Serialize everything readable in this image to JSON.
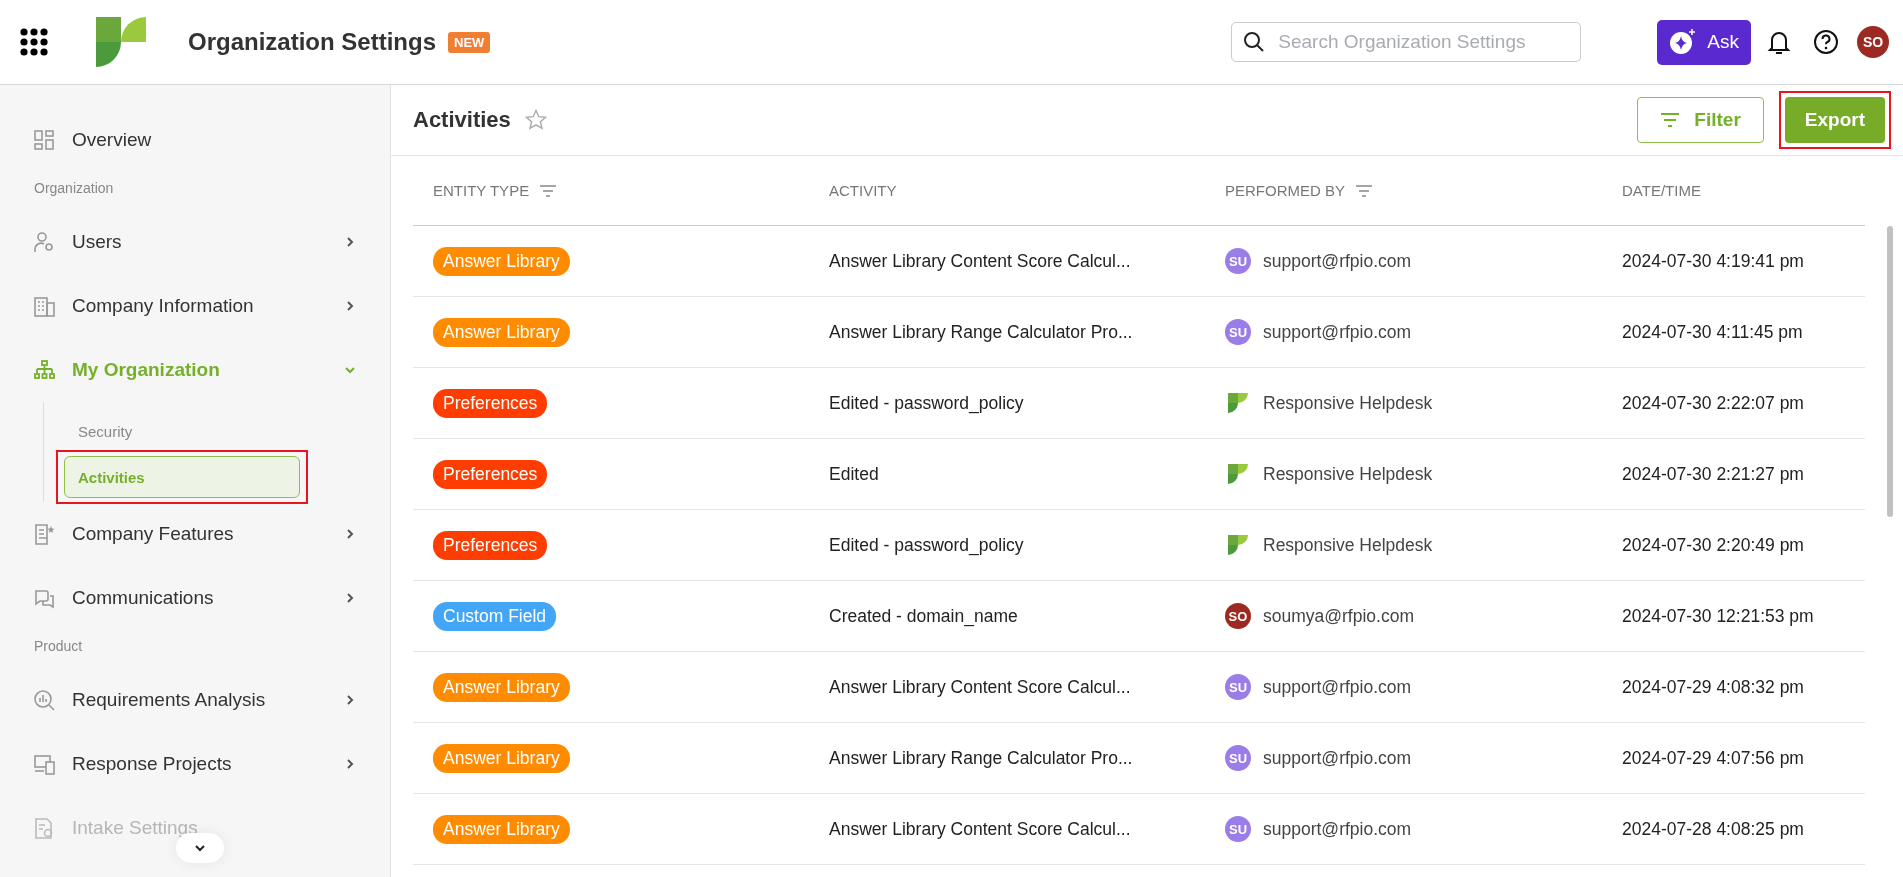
{
  "header": {
    "title": "Organization Settings",
    "badge": "NEW",
    "search": {
      "placeholder": "Search Organization Settings"
    },
    "ask_button": "Ask",
    "user_avatar": "SO"
  },
  "sidebar": {
    "items": [
      {
        "kind": "link",
        "label": "Overview",
        "selected": false,
        "disabled": false
      },
      {
        "kind": "heading",
        "label": "Organization"
      },
      {
        "kind": "group",
        "label": "Users",
        "selected": false,
        "expanded": false,
        "disabled": false
      },
      {
        "kind": "group",
        "label": "Company Information",
        "selected": false,
        "expanded": false,
        "disabled": false
      },
      {
        "kind": "group",
        "label": "My Organization",
        "selected": true,
        "expanded": true,
        "disabled": false,
        "children": [
          {
            "label": "Security",
            "selected": false,
            "highlighted": false
          },
          {
            "label": "Activities",
            "selected": true,
            "highlighted": true
          }
        ]
      },
      {
        "kind": "group",
        "label": "Company Features",
        "selected": false,
        "expanded": false,
        "disabled": false
      },
      {
        "kind": "group",
        "label": "Communications",
        "selected": false,
        "expanded": false,
        "disabled": false
      },
      {
        "kind": "heading",
        "label": "Product"
      },
      {
        "kind": "group",
        "label": "Requirements Analysis",
        "selected": false,
        "expanded": false,
        "disabled": false
      },
      {
        "kind": "group",
        "label": "Response Projects",
        "selected": false,
        "expanded": false,
        "disabled": false
      },
      {
        "kind": "link",
        "label": "Intake Settings",
        "selected": false,
        "disabled": true
      }
    ]
  },
  "main": {
    "title": "Activities",
    "favorite": false,
    "filter_button": "Filter",
    "export_button": {
      "label": "Export",
      "highlighted": true
    },
    "table": {
      "columns": [
        {
          "label": "ENTITY TYPE",
          "filterable": true
        },
        {
          "label": "ACTIVITY",
          "filterable": false
        },
        {
          "label": "PERFORMED BY",
          "filterable": true
        },
        {
          "label": "DATE/TIME",
          "filterable": false
        }
      ],
      "rows": [
        {
          "entity": {
            "label": "Answer Library",
            "color": "#ff8c00"
          },
          "activity": "Answer Library Content Score Calcul...",
          "performer": {
            "kind": "user",
            "initials": "SU",
            "color": "#9a7de6",
            "name": "support@rfpio.com"
          },
          "datetime": "2024-07-30 4:19:41 pm"
        },
        {
          "entity": {
            "label": "Answer Library",
            "color": "#ff8c00"
          },
          "activity": "Answer Library Range Calculator Pro...",
          "performer": {
            "kind": "user",
            "initials": "SU",
            "color": "#9a7de6",
            "name": "support@rfpio.com"
          },
          "datetime": "2024-07-30 4:11:45 pm"
        },
        {
          "entity": {
            "label": "Preferences",
            "color": "#ff3d00"
          },
          "activity": "Edited - password_policy",
          "performer": {
            "kind": "system",
            "name": "Responsive Helpdesk"
          },
          "datetime": "2024-07-30 2:22:07 pm"
        },
        {
          "entity": {
            "label": "Preferences",
            "color": "#ff3d00"
          },
          "activity": "Edited",
          "performer": {
            "kind": "system",
            "name": "Responsive Helpdesk"
          },
          "datetime": "2024-07-30 2:21:27 pm"
        },
        {
          "entity": {
            "label": "Preferences",
            "color": "#ff3d00"
          },
          "activity": "Edited - password_policy",
          "performer": {
            "kind": "system",
            "name": "Responsive Helpdesk"
          },
          "datetime": "2024-07-30 2:20:49 pm"
        },
        {
          "entity": {
            "label": "Custom Field",
            "color": "#42a5f5"
          },
          "activity": "Created - domain_name",
          "performer": {
            "kind": "user",
            "initials": "SO",
            "color": "#9c2a22",
            "name": "soumya@rfpio.com"
          },
          "datetime": "2024-07-30 12:21:53 pm"
        },
        {
          "entity": {
            "label": "Answer Library",
            "color": "#ff8c00"
          },
          "activity": "Answer Library Content Score Calcul...",
          "performer": {
            "kind": "user",
            "initials": "SU",
            "color": "#9a7de6",
            "name": "support@rfpio.com"
          },
          "datetime": "2024-07-29 4:08:32 pm"
        },
        {
          "entity": {
            "label": "Answer Library",
            "color": "#ff8c00"
          },
          "activity": "Answer Library Range Calculator Pro...",
          "performer": {
            "kind": "user",
            "initials": "SU",
            "color": "#9a7de6",
            "name": "support@rfpio.com"
          },
          "datetime": "2024-07-29 4:07:56 pm"
        },
        {
          "entity": {
            "label": "Answer Library",
            "color": "#ff8c00"
          },
          "activity": "Answer Library Content Score Calcul...",
          "performer": {
            "kind": "user",
            "initials": "SU",
            "color": "#9a7de6",
            "name": "support@rfpio.com"
          },
          "datetime": "2024-07-28 4:08:25 pm"
        }
      ]
    }
  }
}
